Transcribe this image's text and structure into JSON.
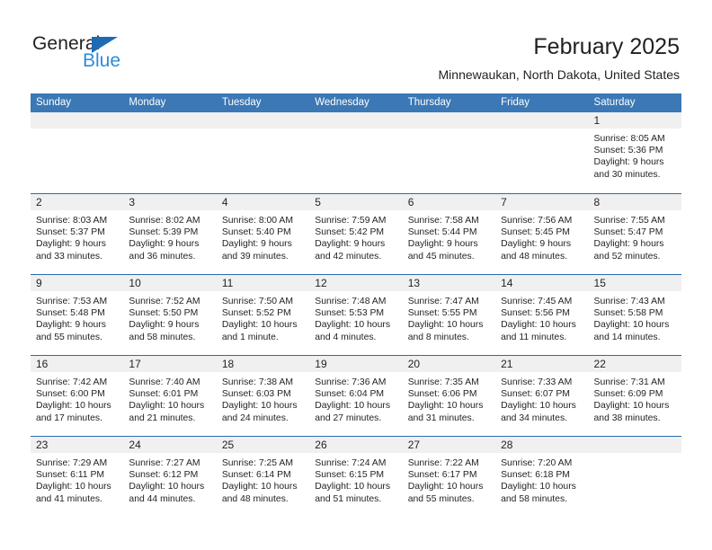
{
  "brand": {
    "name_top": "General",
    "name_bottom": "Blue",
    "triangle_color": "#1e6bb5",
    "blue_text_color": "#2e8bd8"
  },
  "header": {
    "title": "February 2025",
    "subtitle": "Minnewaukan, North Dakota, United States"
  },
  "theme": {
    "header_bg": "#3b78b5",
    "row_rule": "#2c6ca8",
    "daynum_band": "#f0f0f0",
    "text": "#231f20"
  },
  "calendar": {
    "weekdays": [
      "Sunday",
      "Monday",
      "Tuesday",
      "Wednesday",
      "Thursday",
      "Friday",
      "Saturday"
    ],
    "weeks": [
      [
        {
          "day": "",
          "lines": []
        },
        {
          "day": "",
          "lines": []
        },
        {
          "day": "",
          "lines": []
        },
        {
          "day": "",
          "lines": []
        },
        {
          "day": "",
          "lines": []
        },
        {
          "day": "",
          "lines": []
        },
        {
          "day": "1",
          "lines": [
            "Sunrise: 8:05 AM",
            "Sunset: 5:36 PM",
            "Daylight: 9 hours",
            "and 30 minutes."
          ]
        }
      ],
      [
        {
          "day": "2",
          "lines": [
            "Sunrise: 8:03 AM",
            "Sunset: 5:37 PM",
            "Daylight: 9 hours",
            "and 33 minutes."
          ]
        },
        {
          "day": "3",
          "lines": [
            "Sunrise: 8:02 AM",
            "Sunset: 5:39 PM",
            "Daylight: 9 hours",
            "and 36 minutes."
          ]
        },
        {
          "day": "4",
          "lines": [
            "Sunrise: 8:00 AM",
            "Sunset: 5:40 PM",
            "Daylight: 9 hours",
            "and 39 minutes."
          ]
        },
        {
          "day": "5",
          "lines": [
            "Sunrise: 7:59 AM",
            "Sunset: 5:42 PM",
            "Daylight: 9 hours",
            "and 42 minutes."
          ]
        },
        {
          "day": "6",
          "lines": [
            "Sunrise: 7:58 AM",
            "Sunset: 5:44 PM",
            "Daylight: 9 hours",
            "and 45 minutes."
          ]
        },
        {
          "day": "7",
          "lines": [
            "Sunrise: 7:56 AM",
            "Sunset: 5:45 PM",
            "Daylight: 9 hours",
            "and 48 minutes."
          ]
        },
        {
          "day": "8",
          "lines": [
            "Sunrise: 7:55 AM",
            "Sunset: 5:47 PM",
            "Daylight: 9 hours",
            "and 52 minutes."
          ]
        }
      ],
      [
        {
          "day": "9",
          "lines": [
            "Sunrise: 7:53 AM",
            "Sunset: 5:48 PM",
            "Daylight: 9 hours",
            "and 55 minutes."
          ]
        },
        {
          "day": "10",
          "lines": [
            "Sunrise: 7:52 AM",
            "Sunset: 5:50 PM",
            "Daylight: 9 hours",
            "and 58 minutes."
          ]
        },
        {
          "day": "11",
          "lines": [
            "Sunrise: 7:50 AM",
            "Sunset: 5:52 PM",
            "Daylight: 10 hours",
            "and 1 minute."
          ]
        },
        {
          "day": "12",
          "lines": [
            "Sunrise: 7:48 AM",
            "Sunset: 5:53 PM",
            "Daylight: 10 hours",
            "and 4 minutes."
          ]
        },
        {
          "day": "13",
          "lines": [
            "Sunrise: 7:47 AM",
            "Sunset: 5:55 PM",
            "Daylight: 10 hours",
            "and 8 minutes."
          ]
        },
        {
          "day": "14",
          "lines": [
            "Sunrise: 7:45 AM",
            "Sunset: 5:56 PM",
            "Daylight: 10 hours",
            "and 11 minutes."
          ]
        },
        {
          "day": "15",
          "lines": [
            "Sunrise: 7:43 AM",
            "Sunset: 5:58 PM",
            "Daylight: 10 hours",
            "and 14 minutes."
          ]
        }
      ],
      [
        {
          "day": "16",
          "lines": [
            "Sunrise: 7:42 AM",
            "Sunset: 6:00 PM",
            "Daylight: 10 hours",
            "and 17 minutes."
          ]
        },
        {
          "day": "17",
          "lines": [
            "Sunrise: 7:40 AM",
            "Sunset: 6:01 PM",
            "Daylight: 10 hours",
            "and 21 minutes."
          ]
        },
        {
          "day": "18",
          "lines": [
            "Sunrise: 7:38 AM",
            "Sunset: 6:03 PM",
            "Daylight: 10 hours",
            "and 24 minutes."
          ]
        },
        {
          "day": "19",
          "lines": [
            "Sunrise: 7:36 AM",
            "Sunset: 6:04 PM",
            "Daylight: 10 hours",
            "and 27 minutes."
          ]
        },
        {
          "day": "20",
          "lines": [
            "Sunrise: 7:35 AM",
            "Sunset: 6:06 PM",
            "Daylight: 10 hours",
            "and 31 minutes."
          ]
        },
        {
          "day": "21",
          "lines": [
            "Sunrise: 7:33 AM",
            "Sunset: 6:07 PM",
            "Daylight: 10 hours",
            "and 34 minutes."
          ]
        },
        {
          "day": "22",
          "lines": [
            "Sunrise: 7:31 AM",
            "Sunset: 6:09 PM",
            "Daylight: 10 hours",
            "and 38 minutes."
          ]
        }
      ],
      [
        {
          "day": "23",
          "lines": [
            "Sunrise: 7:29 AM",
            "Sunset: 6:11 PM",
            "Daylight: 10 hours",
            "and 41 minutes."
          ]
        },
        {
          "day": "24",
          "lines": [
            "Sunrise: 7:27 AM",
            "Sunset: 6:12 PM",
            "Daylight: 10 hours",
            "and 44 minutes."
          ]
        },
        {
          "day": "25",
          "lines": [
            "Sunrise: 7:25 AM",
            "Sunset: 6:14 PM",
            "Daylight: 10 hours",
            "and 48 minutes."
          ]
        },
        {
          "day": "26",
          "lines": [
            "Sunrise: 7:24 AM",
            "Sunset: 6:15 PM",
            "Daylight: 10 hours",
            "and 51 minutes."
          ]
        },
        {
          "day": "27",
          "lines": [
            "Sunrise: 7:22 AM",
            "Sunset: 6:17 PM",
            "Daylight: 10 hours",
            "and 55 minutes."
          ]
        },
        {
          "day": "28",
          "lines": [
            "Sunrise: 7:20 AM",
            "Sunset: 6:18 PM",
            "Daylight: 10 hours",
            "and 58 minutes."
          ]
        },
        {
          "day": "",
          "lines": []
        }
      ]
    ]
  }
}
